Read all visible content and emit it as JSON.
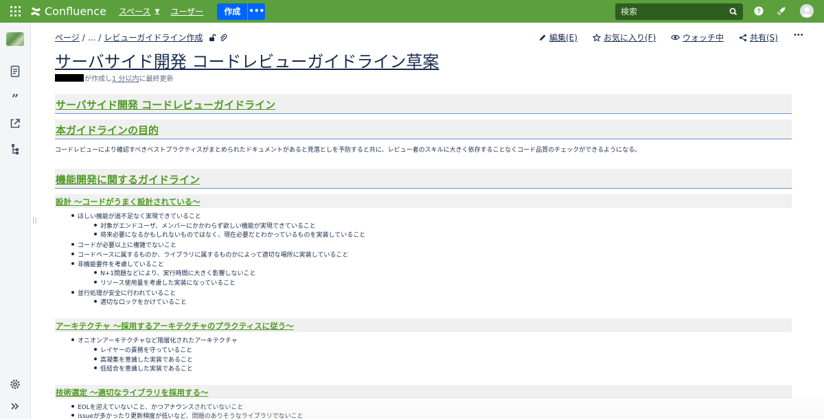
{
  "topbar": {
    "product": "Confluence",
    "nav": [
      "スペース",
      "ユーザー"
    ],
    "create_label": "作成",
    "create_more": "•••",
    "search_placeholder": "検索",
    "brand_color": "#5ba03d"
  },
  "breadcrumb": {
    "root": "ページ",
    "ellipsis": "...",
    "parent": "レビューガイドライン作成"
  },
  "actions": {
    "edit": "編集(E)",
    "favorite": "お気に入り(F)",
    "watch": "ウォッチ中",
    "share": "共有(S)",
    "more": "•••"
  },
  "page": {
    "title": "サーバサイド開発 コードレビューガイドライン草案",
    "byline_created": "が作成し",
    "byline_time": "1 分以内",
    "byline_updated": "に最終更新"
  },
  "content": {
    "h_main": "サーバサイド開発 コードレビューガイドライン",
    "h_purpose": "本ガイドラインの目的",
    "purpose_text": "コードレビューにより確認すべきベストプラクティスがまとめられたドキュメントがあると見落としを予防すると共に、レビュー者のスキルに大きく依存することなくコード品質のチェックができるようになる。",
    "h_feature": "機能開発に関するガイドライン",
    "h_design": "設計 〜コードがうまく設計されている〜",
    "design_items": [
      "ほしい機能が過不足なく実現できていること",
      "対象がエンドユーザ、メンバーにかかわらず欲しい機能が実現できていること",
      "将来必要になるかもしれないものではなく、現在必要だとわかっているものを実装していること",
      "コードが必要以上に複雑でないこと",
      "コードベースに属するものか、ライブラリに属するものかによって適切な場所に実装していること",
      "非機能要件を考慮していること",
      "N+1問題などにより、実行時間に大きく影響しないこと",
      "リソース使用量を考慮した実装になっていること",
      "並行処理が安全に行われていること",
      "適切なロックをかけていること"
    ],
    "h_arch": "アーキテクチャ 〜採用するアーキテクチャのプラクティスに従う〜",
    "arch_items": [
      "オニオンアーキテクチャなど階層化されたアーキテクチャ",
      "レイヤーの責務を守っていること",
      "高凝集を意識した実装であること",
      "低結合を意識した実装であること"
    ],
    "h_tech": "技術選定 〜適切なライブラリを採用する〜",
    "tech_items": [
      "EOLを迎えていないこと、かつアナウンスされていないこと",
      "issueが多かったり更新頻度が低いなど、問題のありそうなライブラリでないこと"
    ]
  }
}
